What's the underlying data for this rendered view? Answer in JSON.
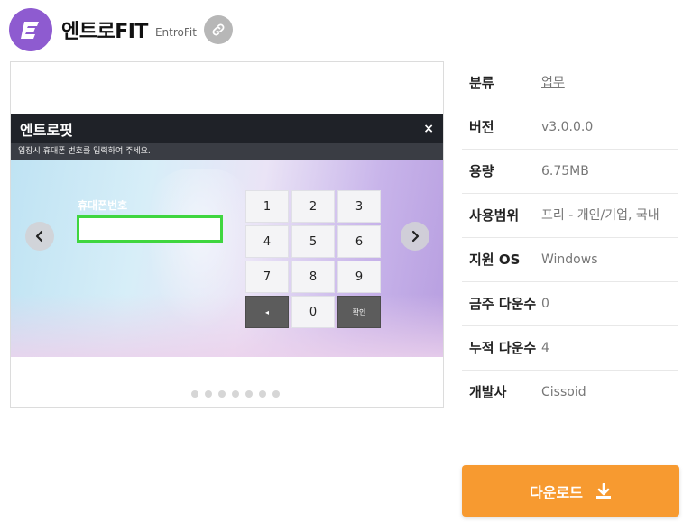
{
  "header": {
    "title": "엔트로FIT",
    "subtitle": "EntroFit"
  },
  "screenshot": {
    "window_title": "엔트로핏",
    "close_glyph": "×",
    "instruction": "입장시 휴대폰 번호를 입력하여 주세요.",
    "phone_label": "휴대폰번호",
    "phone_value": "",
    "keys": [
      "1",
      "2",
      "3",
      "4",
      "5",
      "6",
      "7",
      "8",
      "9",
      "◂",
      "0",
      "확인"
    ],
    "accent_input_border": "#3fd63f"
  },
  "gallery": {
    "dot_count": 7
  },
  "info": {
    "rows": [
      {
        "key": "분류",
        "value": "업무"
      },
      {
        "key": "버전",
        "value": "v3.0.0.0"
      },
      {
        "key": "용량",
        "value": "6.75MB"
      },
      {
        "key": "사용범위",
        "value": "프리 - 개인/기업, 국내"
      },
      {
        "key": "지원 OS",
        "value": "Windows"
      },
      {
        "key": "금주 다운수",
        "value": "0"
      },
      {
        "key": "누적 다운수",
        "value": "4"
      },
      {
        "key": "개발사",
        "value": "Cissoid"
      }
    ]
  },
  "download": {
    "label": "다운로드",
    "color": "#f79a30"
  },
  "icons": {
    "logo": "entrofit-logo",
    "link": "link-icon",
    "prev": "chevron-left-icon",
    "next": "chevron-right-icon",
    "download": "download-icon"
  }
}
